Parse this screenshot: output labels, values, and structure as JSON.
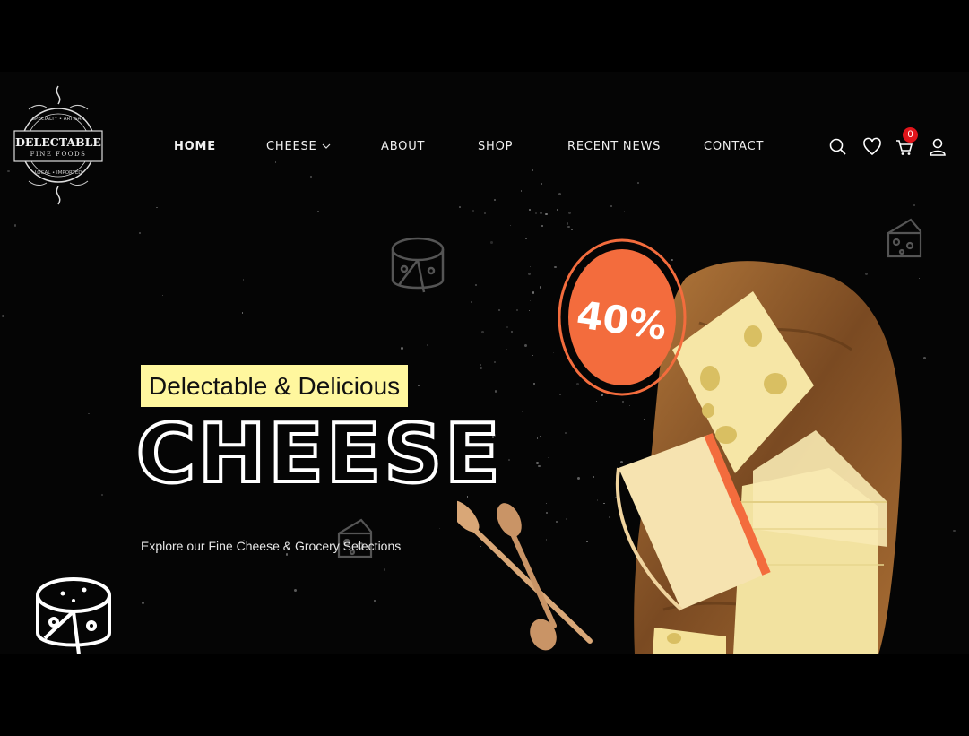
{
  "brand": {
    "name": "DELECTABLE",
    "tagline": "FINE FOODS",
    "ring_top": "SPECIALTY • ARTISAN",
    "ring_bottom": "LOCAL • IMPORTED"
  },
  "nav": {
    "items": [
      {
        "label": "HOME",
        "active": true
      },
      {
        "label": "CHEESE",
        "dropdown": true
      },
      {
        "label": "ABOUT"
      },
      {
        "label": "SHOP"
      },
      {
        "label": "RECENT NEWS"
      },
      {
        "label": "CONTACT"
      }
    ]
  },
  "header_icons": {
    "search": "search-icon",
    "wishlist": "heart-icon",
    "cart": "cart-icon",
    "cart_count": "0",
    "account": "user-icon"
  },
  "hero": {
    "tagline": "Delectable & Delicious",
    "headline": "CHEESE",
    "subtitle": "Explore our Fine Cheese & Grocery Selections",
    "discount": "40%"
  },
  "colors": {
    "background": "#050505",
    "tagline_bg": "#fff79e",
    "discount_badge": "#f36c3d",
    "cart_badge": "#e0151b",
    "board": "#8b5a2b",
    "cheese": "#f4e29a"
  }
}
